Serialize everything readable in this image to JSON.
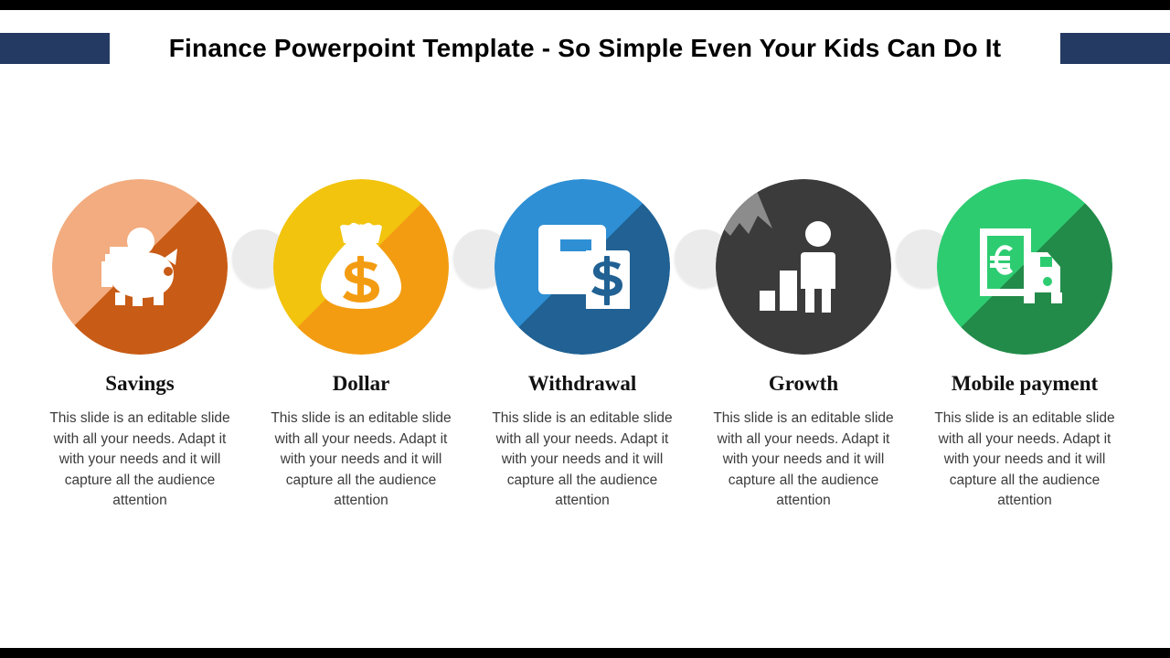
{
  "slide": {
    "title": "Finance Powerpoint Template - So Simple Even Your Kids Can Do It",
    "title_accent_color": "#243A63",
    "background_color": "#FFFFFF",
    "letterbox_color": "#000000"
  },
  "body_text": "This slide is an editable slide with all your needs. Adapt it with your needs and it will capture all the audience attention",
  "items": [
    {
      "label": "Savings",
      "icon": "piggy-bank-icon",
      "color_base": "#C85B15",
      "color_light": "#F2AC7F",
      "description": "This slide is an editable slide with all your needs. Adapt it with your needs and it will capture all the audience attention"
    },
    {
      "label": "Dollar",
      "icon": "money-bag-icon",
      "color_base": "#F39C12",
      "color_light": "#F2C40E",
      "description": "This slide is an editable slide with all your needs. Adapt it with your needs and it will capture all the audience attention"
    },
    {
      "label": "Withdrawal",
      "icon": "atm-machine-icon",
      "color_base": "#2E8FD4",
      "color_light": "#216193",
      "description": "This slide is an editable slide with all your needs. Adapt it with your needs and it will capture all the audience attention"
    },
    {
      "label": "Growth",
      "icon": "growth-person-chart-icon",
      "color_base": "#3B3B3B",
      "color_light": "#8C8C8C",
      "description": "This slide is an editable slide with all your needs. Adapt it with your needs and it will capture all the audience attention"
    },
    {
      "label": "Mobile payment",
      "icon": "euro-note-truck-icon",
      "color_base": "#2ECC71",
      "color_light": "#228B49",
      "description": "This slide is an editable slide with all your needs. Adapt it with your needs and it will capture all the audience attention"
    }
  ],
  "connectors": {
    "count": 4,
    "color": "#E8E8E8"
  }
}
